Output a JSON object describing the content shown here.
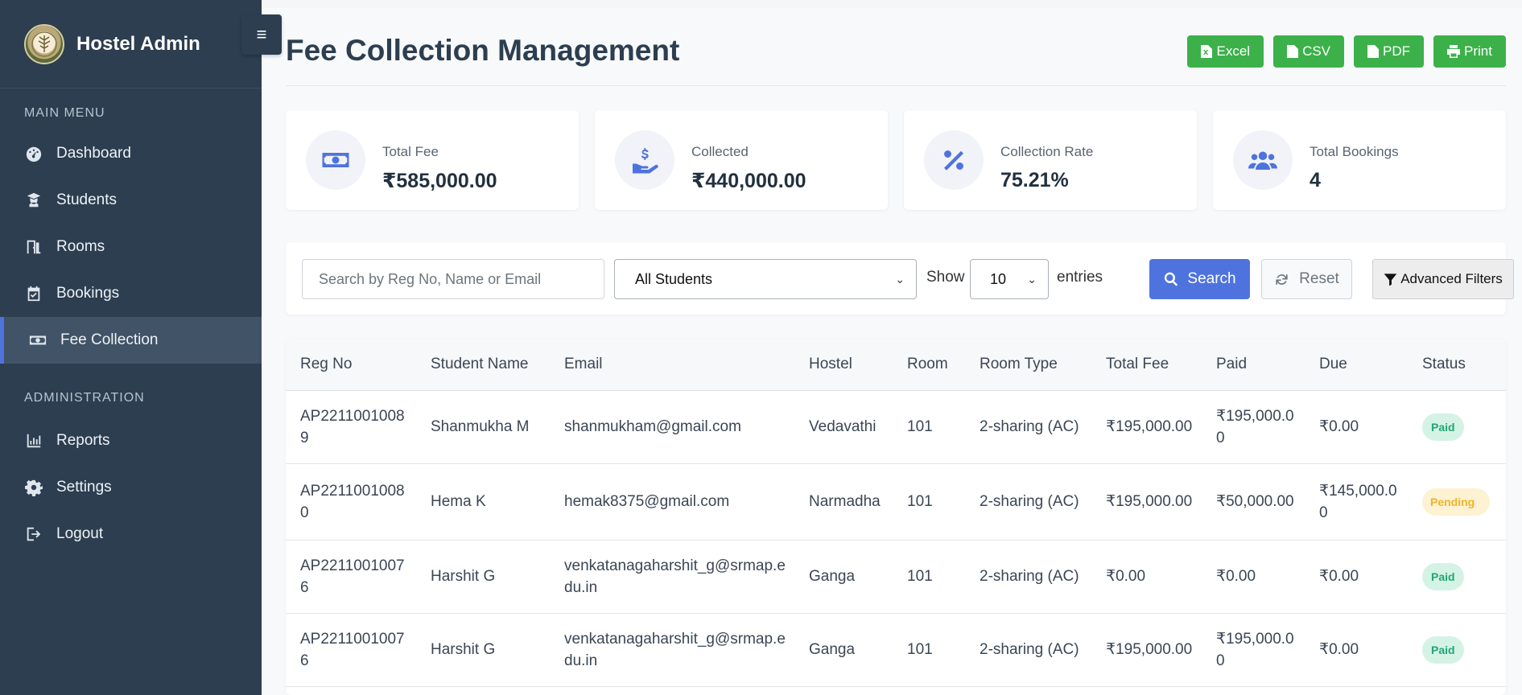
{
  "sidebar": {
    "brand": "Hostel Admin",
    "main_heading": "MAIN MENU",
    "admin_heading": "ADMINISTRATION",
    "main_items": [
      {
        "label": "Dashboard",
        "icon": "dashboard-icon"
      },
      {
        "label": "Students",
        "icon": "student-icon"
      },
      {
        "label": "Rooms",
        "icon": "door-icon"
      },
      {
        "label": "Bookings",
        "icon": "calendar-check-icon"
      },
      {
        "label": "Fee Collection",
        "icon": "money-bill-icon",
        "active": true
      }
    ],
    "admin_items": [
      {
        "label": "Reports",
        "icon": "chart-icon"
      },
      {
        "label": "Settings",
        "icon": "gear-icon"
      },
      {
        "label": "Logout",
        "icon": "logout-icon"
      }
    ]
  },
  "header": {
    "title": "Fee Collection Management",
    "exports": [
      "Excel",
      "CSV",
      "PDF",
      "Print"
    ]
  },
  "stats": [
    {
      "label": "Total Fee",
      "value": "₹585,000.00",
      "icon": "money-bill-icon"
    },
    {
      "label": "Collected",
      "value": "₹440,000.00",
      "icon": "hand-dollar-icon"
    },
    {
      "label": "Collection Rate",
      "value": "75.21%",
      "icon": "percent-icon"
    },
    {
      "label": "Total Bookings",
      "value": "4",
      "icon": "users-icon"
    }
  ],
  "filters": {
    "search_placeholder": "Search by Reg No, Name or Email",
    "student_filter": "All Students",
    "show_label": "Show",
    "entries_value": "10",
    "entries_label": "entries",
    "search_button": "Search",
    "reset_button": "Reset",
    "advanced_button": "Advanced Filters"
  },
  "table": {
    "columns": [
      "Reg No",
      "Student Name",
      "Email",
      "Hostel",
      "Room",
      "Room Type",
      "Total Fee",
      "Paid",
      "Due",
      "Status"
    ],
    "rows": [
      {
        "reg": "AP22110010089",
        "name": "Shanmukha M",
        "email": "shanmukham@gmail.com",
        "hostel": "Vedavathi",
        "room": "101",
        "type": "2-sharing (AC)",
        "total": "₹195,000.00",
        "paid": "₹195,000.00",
        "due": "₹0.00",
        "status": "Paid"
      },
      {
        "reg": "AP22110010080",
        "name": "Hema K",
        "email": "hemak8375@gmail.com",
        "hostel": "Narmadha",
        "room": "101",
        "type": "2-sharing (AC)",
        "total": "₹195,000.00",
        "paid": "₹50,000.00",
        "due": "₹145,000.00",
        "status": "Pending"
      },
      {
        "reg": "AP22110010076",
        "name": "Harshit G",
        "email": "venkatanagaharshit_g@srmap.edu.in",
        "hostel": "Ganga",
        "room": "101",
        "type": "2-sharing (AC)",
        "total": "₹0.00",
        "paid": "₹0.00",
        "due": "₹0.00",
        "status": "Paid"
      },
      {
        "reg": "AP22110010076",
        "name": "Harshit G",
        "email": "venkatanagaharshit_g@srmap.edu.in",
        "hostel": "Ganga",
        "room": "101",
        "type": "2-sharing (AC)",
        "total": "₹195,000.00",
        "paid": "₹195,000.00",
        "due": "₹0.00",
        "status": "Paid"
      }
    ]
  },
  "colors": {
    "sidebar": "#2c3e50",
    "accent": "#4e73df",
    "export": "#3cb14a",
    "paid": "#22a673",
    "pending": "#f0b32a"
  }
}
